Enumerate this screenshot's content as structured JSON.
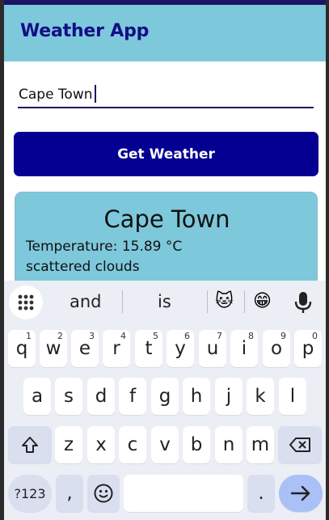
{
  "app": {
    "title": "Weather App",
    "city_input": {
      "value": "Cape Town"
    },
    "get_button_label": "Get Weather",
    "result": {
      "city": "Cape Town",
      "temperature_line": "Temperature: 15.89 °C",
      "description": "scattered clouds"
    },
    "colors": {
      "appbar": "#7ec8dc",
      "button": "#050092",
      "title": "#140e86",
      "card": "#7ec8dc"
    }
  },
  "keyboard": {
    "suggestions": [
      "and",
      "is"
    ],
    "emoji_suggestions": [
      "🐱",
      "😁"
    ],
    "icons": {
      "apps": "apps-grid-icon",
      "mic": "microphone-icon",
      "shift": "shift-icon",
      "backspace": "backspace-icon",
      "emoji": "emoji-icon",
      "enter": "arrow-right-icon"
    },
    "row1": [
      {
        "key": "q",
        "sup": "1"
      },
      {
        "key": "w",
        "sup": "2"
      },
      {
        "key": "e",
        "sup": "3"
      },
      {
        "key": "r",
        "sup": "4"
      },
      {
        "key": "t",
        "sup": "5"
      },
      {
        "key": "y",
        "sup": "6"
      },
      {
        "key": "u",
        "sup": "7"
      },
      {
        "key": "i",
        "sup": "8"
      },
      {
        "key": "o",
        "sup": "9"
      },
      {
        "key": "p",
        "sup": "0"
      }
    ],
    "row2": [
      "a",
      "s",
      "d",
      "f",
      "g",
      "h",
      "j",
      "k",
      "l"
    ],
    "row3": [
      "z",
      "x",
      "c",
      "v",
      "b",
      "n",
      "m"
    ],
    "bottom": {
      "symbols": "?123",
      "comma": ",",
      "period": "."
    }
  }
}
